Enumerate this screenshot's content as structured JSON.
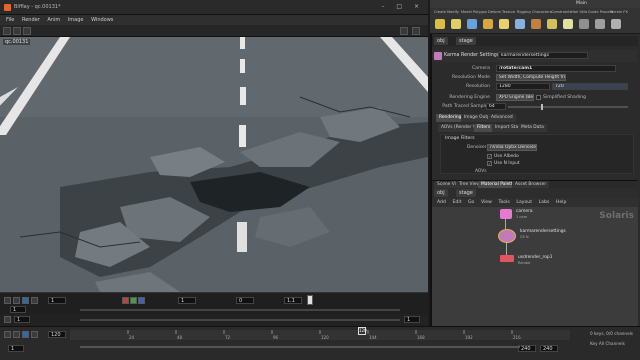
{
  "window": {
    "title": "Bifflay - qc.00131*"
  },
  "menu": [
    "File",
    "Render",
    "Anim",
    "Image",
    "Windows"
  ],
  "viewport": {
    "label": "qc.00131"
  },
  "timeline_top": {
    "frame": "1",
    "end": "1",
    "step": "0",
    "zoom": "1.1",
    "mark": "1"
  },
  "timeline_mid": {
    "start": "1",
    "end": "1"
  },
  "global_timeline": {
    "current_frame": "1",
    "start_field": "1",
    "end_fields": [
      "240",
      "240"
    ],
    "ticks": [
      "24",
      "48",
      "72",
      "96",
      "120",
      "144",
      "168",
      "192",
      "216"
    ],
    "current_marker": "120",
    "keys_label": "0 keys, 0/0 channels",
    "key_all_label": "Key All Channels",
    "frame_left": "120"
  },
  "right_title": "Main",
  "shelf_tabs": [
    "Create",
    "Modify",
    "Model",
    "Polygon",
    "Deform",
    "Texture",
    "Rigging",
    "Characters",
    "Constraints",
    "Hair Utils",
    "Guide Process",
    "Terrain FX",
    "Simple FX",
    "Cloud FX",
    "Volume"
  ],
  "shelf_items": [
    "Distant Light",
    "Light",
    "Sky",
    "Quick",
    "Area Light",
    "Dome Light",
    "Material",
    "Portal Light",
    "Ambient Light",
    "Stereo Camera",
    "VR Camera",
    "Gamepad Camera"
  ],
  "path": {
    "root": "obj",
    "node": "stage"
  },
  "node": {
    "type": "Karma Render Settings",
    "name": "karmarendersettings"
  },
  "params": {
    "camera_label": "Camera",
    "camera_value": "/rotate/cam1",
    "resolution_mode_label": "Resolution Mode",
    "resolution_mode_value": "Set Width, Compute Height from Camera",
    "resolution_label": "Resolution",
    "resolution_w": "1280",
    "resolution_h": "720",
    "engine_label": "Rendering Engine",
    "engine_value": "XPU Engine (Beta)",
    "simplified_shading": "Simplified Shading",
    "samples_label": "Path Traced Samples",
    "samples_value": "64"
  },
  "param_tabs": [
    "Rendering",
    "Image Output",
    "Advanced"
  ],
  "sub_tabs": [
    "AOVs (Render Vars)",
    "Filters",
    "Import Statics",
    "Meta Data"
  ],
  "image_filters": {
    "section": "Image Filters",
    "denoiser_label": "Denoiser",
    "denoiser_value": "nVidia Optix Denoiser",
    "use_albedo": "Use Albedo",
    "use_n_input": "Use N Input",
    "aovs_label": "AOVs"
  },
  "network": {
    "tabs": [
      "Scene View",
      "Tree View",
      "Material Palette",
      "Asset Browser"
    ],
    "menu": [
      "Add",
      "Edit",
      "Go",
      "View",
      "Tools",
      "Layout",
      "Labs",
      "Help"
    ],
    "watermark": "Solaris",
    "nodes": [
      {
        "name": "camera",
        "sub": "1 cam",
        "color": "#e57ad1"
      },
      {
        "name": "karmarendersettings",
        "sub": "CE N",
        "color": "#c27ab8"
      },
      {
        "name": "usdrender_rop1",
        "sub": "Render",
        "color": "#e05560"
      }
    ]
  },
  "colors": {
    "accent": "#e5662a",
    "selected_node": "#d9b84a",
    "viewport_frame": "#5b8dd9"
  }
}
